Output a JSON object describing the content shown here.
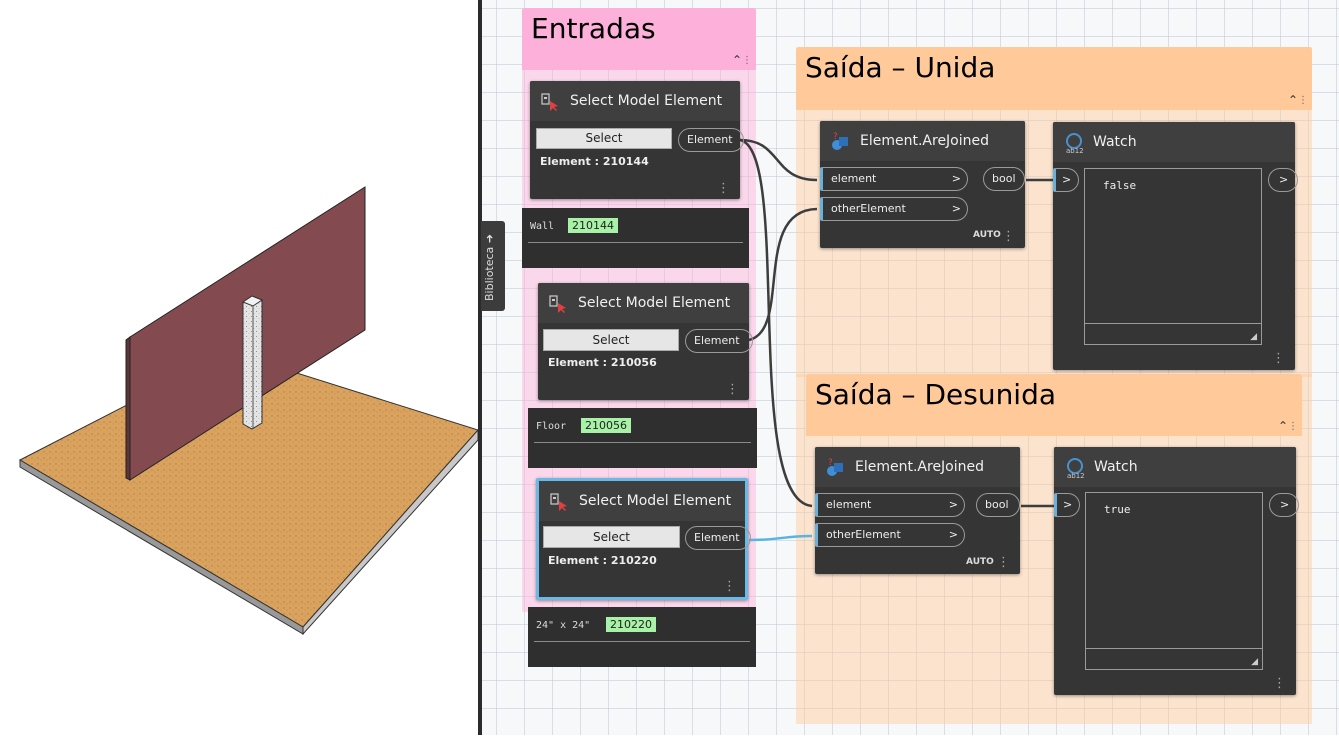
{
  "library_tab": "Biblioteca",
  "groups": {
    "inputs": {
      "title": "Entradas",
      "color": "#fdb0d9"
    },
    "joined": {
      "title": "Saída – Unida",
      "color": "#ffc999"
    },
    "unjoined": {
      "title": "Saída – Desunida",
      "color": "#ffc999"
    }
  },
  "select_nodes": [
    {
      "title": "Select Model Element",
      "button": "Select",
      "output": "Element",
      "element_label": "Element : 210144",
      "preview_type": "Wall",
      "preview_id": "210144"
    },
    {
      "title": "Select Model Element",
      "button": "Select",
      "output": "Element",
      "element_label": "Element : 210056",
      "preview_type": "Floor",
      "preview_id": "210056"
    },
    {
      "title": "Select Model Element",
      "button": "Select",
      "output": "Element",
      "element_label": "Element : 210220",
      "preview_type": "24\" x 24\"",
      "preview_id": "210220"
    }
  ],
  "are_joined_nodes": [
    {
      "title": "Element.AreJoined",
      "in1": "element",
      "in2": "otherElement",
      "out": "bool",
      "lacing": "AUTO"
    },
    {
      "title": "Element.AreJoined",
      "in1": "element",
      "in2": "otherElement",
      "out": "bool",
      "lacing": "AUTO"
    }
  ],
  "watch_nodes": [
    {
      "title": "Watch",
      "value": "false"
    },
    {
      "title": "Watch",
      "value": "true"
    }
  ],
  "port_arrow": ">"
}
